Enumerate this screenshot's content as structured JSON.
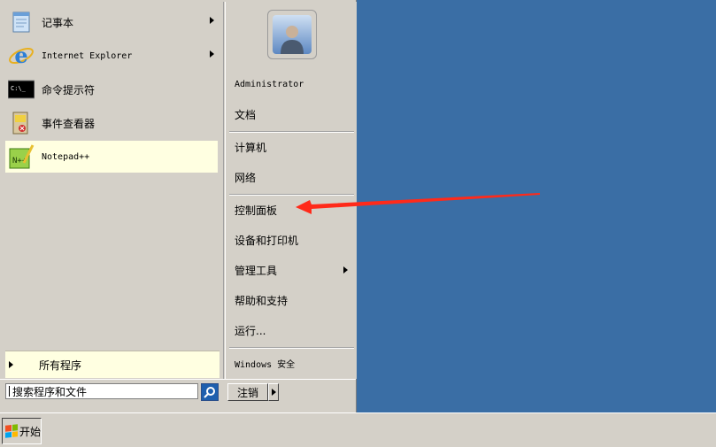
{
  "start_menu": {
    "programs": [
      {
        "label": "记事本",
        "icon": "notepad-icon",
        "has_submenu": true
      },
      {
        "label": "Internet Explorer",
        "icon": "internet-explorer-icon",
        "has_submenu": true
      },
      {
        "label": "命令提示符",
        "icon": "command-prompt-icon",
        "has_submenu": false
      },
      {
        "label": "事件查看器",
        "icon": "event-viewer-icon",
        "has_submenu": false
      },
      {
        "label": "Notepad++",
        "icon": "notepadpp-icon",
        "has_submenu": false
      }
    ],
    "all_programs_label": "所有程序",
    "search_placeholder": "搜索程序和文件",
    "logoff_label": "注销",
    "user_name": "Administrator",
    "right_items": [
      {
        "label": "文档"
      },
      {
        "label": "计算机"
      },
      {
        "label": "网络"
      },
      {
        "label": "控制面板"
      },
      {
        "label": "设备和打印机"
      },
      {
        "label": "管理工具",
        "has_submenu": true
      },
      {
        "label": "帮助和支持"
      },
      {
        "label": "运行..."
      },
      {
        "label": "Windows 安全"
      }
    ]
  },
  "taskbar": {
    "start_label": "开始"
  },
  "colors": {
    "desktop": "#3a6ea5",
    "menu_bg": "#d4d0c8",
    "highlight": "#ffffe1",
    "annotation_arrow": "#ff2a1a"
  }
}
